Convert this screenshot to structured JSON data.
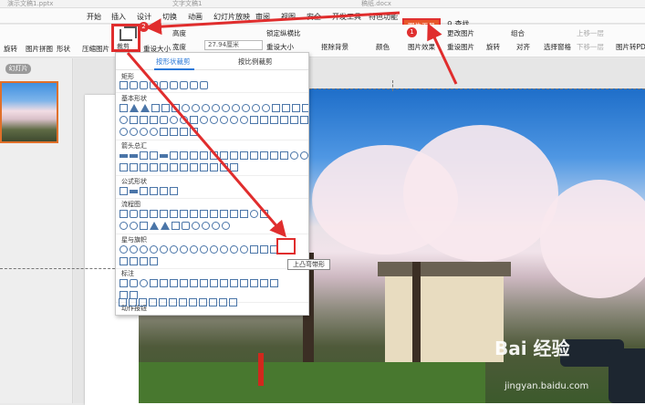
{
  "window": {
    "tabs": [
      "演示文稿1.pptx",
      "文字文稿1",
      "稿纸.docx"
    ]
  },
  "menubar": {
    "items": [
      "开始",
      "插入",
      "设计",
      "切换",
      "动画",
      "幻灯片放映",
      "审阅",
      "视图",
      "安全",
      "开发工具",
      "特色功能"
    ],
    "picture_tools": "图片工具",
    "search": "查找"
  },
  "toolbar": {
    "left": [
      "旋转",
      "图片拼图",
      "形状"
    ],
    "compress": "压缩图片",
    "crop": "裁剪",
    "reset_size": "重设大小",
    "reset_picture": "设置图片",
    "height_label": "高度",
    "width_label": "宽度",
    "width_value": "27.94厘米",
    "lock_ratio": "锁定纵横比",
    "original_size": "重设大小",
    "remove_bg": "抠除背景",
    "color": "颜色",
    "effects": "图片效果",
    "change_picture": "更改图片",
    "reset_pic": "重设图片",
    "combine": "组合",
    "rotate": "旋转",
    "align": "对齐",
    "select_pane": "选择窗格",
    "prev_layer": "上移一层",
    "next_layer": "下移一层",
    "image_to_pdf": "图片转PDF"
  },
  "left_panel": {
    "tab": "幻灯片"
  },
  "dropdown": {
    "tab_by_shape": "按形状裁剪",
    "tab_by_ratio": "按比例裁剪",
    "sections": [
      "矩形",
      "基本形状",
      "箭头总汇",
      "公式形状",
      "流程图",
      "星与旗帜",
      "标注",
      "动作按钮"
    ],
    "tooltip": "上凸弯带形"
  },
  "badges": [
    "1",
    "2",
    "3"
  ],
  "watermark": {
    "brand": "Bai 经验",
    "url": "jingyan.baidu.com"
  }
}
